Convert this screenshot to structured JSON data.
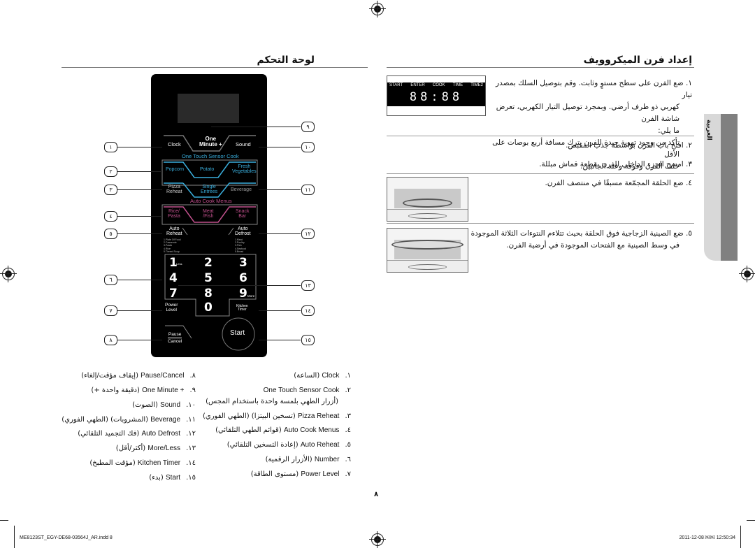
{
  "page": {
    "page_number": "٨",
    "side_tab_label": "العربية",
    "footer_left": "ME8123ST_EGY-DE68-03564J_AR.indd   8",
    "footer_right": "2011-12-08   ￼￼ 12:50:34"
  },
  "left_section": {
    "title": "لوحة التحكم"
  },
  "right_section": {
    "title": "إعداد فرن الميكروويف",
    "display": {
      "labels": [
        "START",
        "ENTER",
        "COOK",
        "TIME",
        "TIME2"
      ],
      "digits": "88:88"
    },
    "steps": [
      {
        "num": "١.",
        "lines": [
          "ضع الفرن على سطح مستوٍ وثابت. وقم بتوصيل السلك بمصدر تيار",
          "كهربي ذو طرف أرضي. وبمجرد توصيل التيار الكهربي، تعرض شاشة الفرن",
          "ما يلي:",
          "تأكد من وجود تهوية جيدة للفرن بترك مسافة أربع بوصات على الأقل",
          "خلف الفرن وفوقه وعند الجانبين."
        ]
      },
      {
        "num": "٢.",
        "lines": [
          "افتح باب الفرن بواسطة جذب المقبض."
        ]
      },
      {
        "num": "٣.",
        "lines": [
          "امسح الجزء الداخلي للفرن بقطعة قماش مبللة."
        ]
      },
      {
        "num": "٤.",
        "lines": [
          "ضع الحلقة المجمّعة مسبقًا في منتصف الفرن."
        ]
      },
      {
        "num": "٥.",
        "lines": [
          "ضع الصينية الزجاجية فوق الحلقة بحيث تتلاءم النتوءات الثلاثة الموجودة",
          "في وسط الصينية مع الفتحات الموجودة في أرضية الفرن."
        ]
      }
    ]
  },
  "control_panel": {
    "one_minute": [
      "One",
      "Minute +"
    ],
    "clock": "Clock",
    "sound": "Sound",
    "sensor_cook_header": "One Touch Sensor Cook",
    "popcorn": "Popcorn",
    "potato": "Potato",
    "fresh_veg": [
      "Fresh",
      "Vegetables"
    ],
    "pizza_reheat": [
      "Pizza",
      "Reheat"
    ],
    "single_entrees": [
      "Single",
      "Entrees"
    ],
    "beverage": "Beverage",
    "auto_cook_header": "Auto Cook Menus",
    "rice_pasta": [
      "Rice/",
      "Pasta"
    ],
    "meat_fish": [
      "Meat",
      "/Fish"
    ],
    "snack_bar": [
      "Snack",
      "Bar"
    ],
    "auto_reheat": [
      "Auto",
      "Reheat"
    ],
    "auto_defrost": [
      "Auto",
      "Defrost"
    ],
    "reheat_list": [
      "1.Plate Of Food",
      "2.Casserole",
      "3.Pasta",
      "4.Rice",
      "5.Tinned Soup"
    ],
    "defrost_list": [
      "1.Meat",
      "2.Poultry",
      "3.Fish",
      "4.Seafood",
      "5.Bread"
    ],
    "keys": [
      "1",
      "2",
      "3",
      "4",
      "5",
      "6",
      "7",
      "8",
      "9",
      "0"
    ],
    "less": "Less",
    "more": "More",
    "power_level": [
      "Power",
      "Level"
    ],
    "kitchen_timer": [
      "Kitchen",
      "Timer"
    ],
    "pause_cancel": [
      "Pause",
      "Cancel"
    ],
    "start": "Start",
    "colors": {
      "sensor": "#3aaedc",
      "auto_cook": "#c0508c"
    },
    "callouts": [
      "١",
      "٢",
      "٣",
      "٤",
      "٥",
      "٦",
      "٧",
      "٨",
      "٩",
      "١٠",
      "١١",
      "١٢",
      "١٣",
      "١٤",
      "١٥"
    ]
  },
  "legend": {
    "right_column": [
      {
        "num": "١.",
        "en": "Clock",
        "ar": "(الساعة)"
      },
      {
        "num": "٢.",
        "en": "One Touch Sensor Cook",
        "ar": ""
      },
      {
        "num": "",
        "en": "",
        "ar": "(أزرار الطهي بلمسة واحدة باستخدام المجس)"
      },
      {
        "num": "٣.",
        "en": "Pizza Reheat",
        "ar": "(تسخين البيتزا) (الطهي الفوري)"
      },
      {
        "num": "٤.",
        "en": "Auto Cook Menus",
        "ar": "(قوائم الطهي التلقائي)"
      },
      {
        "num": "٥.",
        "en": "Auto Reheat",
        "ar": "(إعادة التسخين التلقائي)"
      },
      {
        "num": "٦.",
        "en": "Number",
        "ar": "(الأزرار الرقمية)"
      },
      {
        "num": "٧.",
        "en": "Power Level",
        "ar": "(مستوى الطاقة)"
      }
    ],
    "left_column": [
      {
        "num": "٨.",
        "en": "Pause/Cancel",
        "ar": "(إيقاف مؤقت/إلغاء)"
      },
      {
        "num": "٩.",
        "en": "+ One Minute",
        "ar": "(دقيقة واحدة +)"
      },
      {
        "num": "١٠.",
        "en": "Sound",
        "ar": "(الصوت)"
      },
      {
        "num": "١١.",
        "en": "Beverage",
        "ar": "(المشروبات) (الطهي الفوري)"
      },
      {
        "num": "١٢.",
        "en": "Auto Defrost",
        "ar": "(فك التجميد التلقائي)"
      },
      {
        "num": "١٣.",
        "en": "More/Less",
        "ar": "(أكثر/أقل)"
      },
      {
        "num": "١٤.",
        "en": "Kitchen Timer",
        "ar": "(مؤقت المطبخ)"
      },
      {
        "num": "١٥.",
        "en": "Start",
        "ar": "(بدء)"
      }
    ]
  }
}
